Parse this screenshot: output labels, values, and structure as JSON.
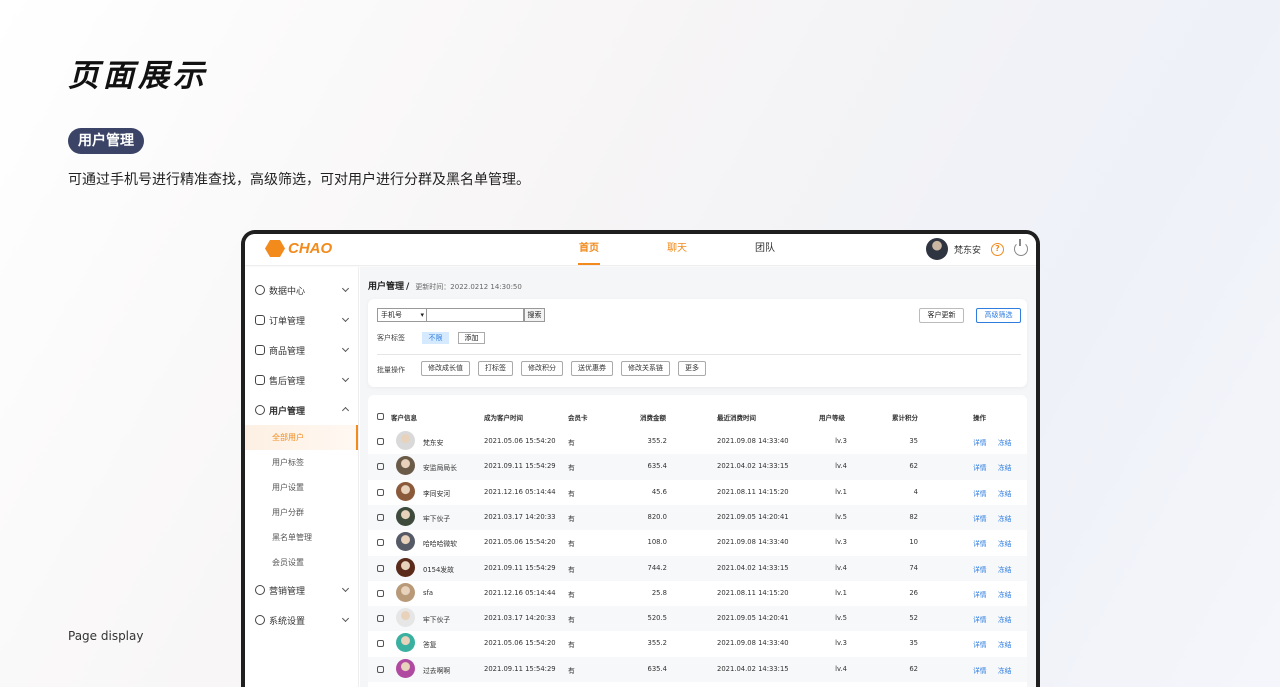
{
  "showcase": {
    "title": "页面展示",
    "section_badge": "用户管理",
    "description": "可通过手机号进行精准查找，高级筛选，可对用户进行分群及黑名单管理。",
    "footer_label": "Page display"
  },
  "app": {
    "logo_text": "CHAO",
    "nav_tabs": [
      "首页",
      "聊天",
      "团队"
    ],
    "user_name": "梵东安",
    "help_icon": "question-circle-icon",
    "power_icon": "power-icon"
  },
  "sidebar": {
    "items": [
      {
        "label": "数据中心",
        "icon": "chart-icon"
      },
      {
        "label": "订单管理",
        "icon": "document-icon"
      },
      {
        "label": "商品管理",
        "icon": "bag-icon"
      },
      {
        "label": "售后管理",
        "icon": "service-icon"
      },
      {
        "label": "用户管理",
        "icon": "user-icon"
      }
    ],
    "sub_items": [
      "全部用户",
      "用户标签",
      "用户设置",
      "用户分群",
      "黑名单管理",
      "会员设置"
    ],
    "bottom_items": [
      {
        "label": "营销管理",
        "icon": "marketing-icon"
      },
      {
        "label": "系统设置",
        "icon": "gear-icon"
      }
    ]
  },
  "main": {
    "breadcrumb": "用户管理",
    "breadcrumb_sep": "/",
    "update_time": "更新时间：2022.0212 14:30:50",
    "filter": {
      "select_value": "手机号",
      "search_placeholder": "",
      "search_button": "搜索",
      "update_button": "客户更新",
      "advanced_button": "高级筛选",
      "tag_label": "客户标签",
      "tag_unlimited": "不限",
      "tag_add": "添加",
      "batch_label": "批量操作",
      "batch_buttons": [
        "修改成长值",
        "打标签",
        "修改积分",
        "送优惠券",
        "修改关系链",
        "更多"
      ]
    },
    "table": {
      "columns": [
        "客户信息",
        "成为客户时间",
        "会员卡",
        "消费金额",
        "最近消费时间",
        "用户等级",
        "累计积分",
        "操作"
      ],
      "action_detail": "详情",
      "action_freeze": "冻结",
      "rows": [
        {
          "name": "梵东安",
          "joined": "2021.05.06 15:54:20",
          "card": "有",
          "amount": "355.2",
          "last": "2021.09.08 14:33:40",
          "level": "lv.3",
          "points": "35",
          "avatar_color": "#d9d9d9"
        },
        {
          "name": "安监局局长",
          "joined": "2021.09.11 15:54:29",
          "card": "有",
          "amount": "635.4",
          "last": "2021.04.02 14:33:15",
          "level": "lv.4",
          "points": "62",
          "avatar_color": "#6a5a48"
        },
        {
          "name": "李同安河",
          "joined": "2021.12.16 05:14:44",
          "card": "有",
          "amount": "45.6",
          "last": "2021.08.11 14:15:20",
          "level": "lv.1",
          "points": "4",
          "avatar_color": "#8a5a3a"
        },
        {
          "name": "牢下伙子",
          "joined": "2021.03.17 14:20:33",
          "card": "有",
          "amount": "820.0",
          "last": "2021.09.05 14:20:41",
          "level": "lv.5",
          "points": "82",
          "avatar_color": "#3d4a3c"
        },
        {
          "name": "哈哈哈微软",
          "joined": "2021.05.06 15:54:20",
          "card": "有",
          "amount": "108.0",
          "last": "2021.09.08 14:33:40",
          "level": "lv.3",
          "points": "10",
          "avatar_color": "#555a66"
        },
        {
          "name": "0154发故",
          "joined": "2021.09.11 15:54:29",
          "card": "有",
          "amount": "744.2",
          "last": "2021.04.02 14:33:15",
          "level": "lv.4",
          "points": "74",
          "avatar_color": "#5a2a1a"
        },
        {
          "name": "sfa",
          "joined": "2021.12.16 05:14:44",
          "card": "有",
          "amount": "25.8",
          "last": "2021.08.11 14:15:20",
          "level": "lv.1",
          "points": "26",
          "avatar_color": "#b89a78"
        },
        {
          "name": "牢下伙子",
          "joined": "2021.03.17 14:20:33",
          "card": "有",
          "amount": "520.5",
          "last": "2021.09.05 14:20:41",
          "level": "lv.5",
          "points": "52",
          "avatar_color": "#e6e6e6"
        },
        {
          "name": "答复",
          "joined": "2021.05.06 15:54:20",
          "card": "有",
          "amount": "355.2",
          "last": "2021.09.08 14:33:40",
          "level": "lv.3",
          "points": "35",
          "avatar_color": "#3ab0a0"
        },
        {
          "name": "过去啊啊",
          "joined": "2021.09.11 15:54:29",
          "card": "有",
          "amount": "635.4",
          "last": "2021.04.02 14:33:15",
          "level": "lv.4",
          "points": "62",
          "avatar_color": "#b04aa0"
        }
      ]
    }
  },
  "colors": {
    "accent": "#f28a1c",
    "link": "#2f7ddf",
    "badge": "#3b4466"
  }
}
